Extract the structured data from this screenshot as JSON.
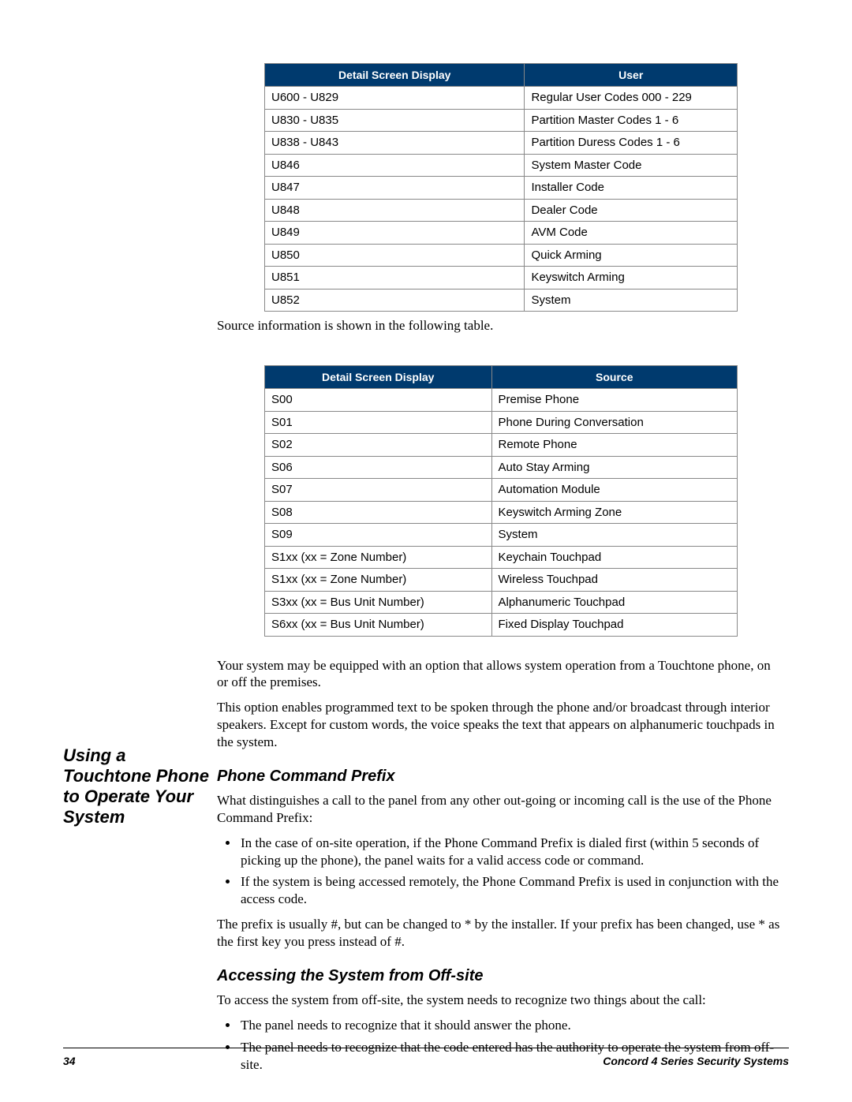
{
  "table1": {
    "headers": [
      "Detail Screen Display",
      "User"
    ],
    "rows": [
      [
        "U600 - U829",
        "Regular User Codes 000 - 229"
      ],
      [
        "U830 - U835",
        "Partition Master Codes 1 - 6"
      ],
      [
        "U838 - U843",
        "Partition Duress Codes 1 - 6"
      ],
      [
        "U846",
        "System Master Code"
      ],
      [
        "U847",
        "Installer Code"
      ],
      [
        "U848",
        "Dealer Code"
      ],
      [
        "U849",
        "AVM Code"
      ],
      [
        "U850",
        "Quick Arming"
      ],
      [
        "U851",
        "Keyswitch Arming"
      ],
      [
        "U852",
        "System"
      ]
    ]
  },
  "caption1": "Source information is shown in the following table.",
  "table2": {
    "headers": [
      "Detail Screen Display",
      "Source"
    ],
    "rows": [
      [
        "S00",
        "Premise Phone"
      ],
      [
        "S01",
        "Phone During Conversation"
      ],
      [
        "S02",
        "Remote Phone"
      ],
      [
        "S06",
        "Auto Stay Arming"
      ],
      [
        "S07",
        "Automation Module"
      ],
      [
        "S08",
        "Keyswitch Arming Zone"
      ],
      [
        "S09",
        "System"
      ],
      [
        "S1xx (xx = Zone Number)",
        "Keychain Touchpad"
      ],
      [
        "S1xx (xx = Zone Number)",
        "Wireless Touchpad"
      ],
      [
        "S3xx (xx = Bus Unit Number)",
        "Alphanumeric Touchpad"
      ],
      [
        "S6xx (xx = Bus Unit Number)",
        "Fixed Display Touchpad"
      ]
    ]
  },
  "side_heading": "Using a Touchtone Phone to Operate Your System",
  "paras": {
    "intro1": "Your system may be equipped with an option that allows system operation from a Touchtone phone, on or off the premises.",
    "intro2": "This option enables programmed text to be spoken through the phone and/or broadcast through interior speakers. Except for custom words, the voice speaks the text that appears on alphanumeric touchpads in the system.",
    "pcp_h": "Phone Command Prefix",
    "pcp1": "What distinguishes a call to the panel from any other out-going or incoming call is the use of the Phone Command Prefix:",
    "pcp_b1": "In the case of on-site operation, if the Phone Command Prefix is dialed first (within 5 seconds of picking up the phone), the panel waits for a valid access code or command.",
    "pcp_b2": "If the system is being accessed remotely, the Phone Command Prefix is used in conjunction with the access code.",
    "pcp2": "The prefix is usually #, but can be changed to * by the installer. If your prefix has been changed, use * as the first key you press instead of #.",
    "acc_h": "Accessing the System from Off-site",
    "acc1": "To access the system from off-site, the system needs to recognize two things about the call:",
    "acc_b1": "The panel needs to recognize that it should answer the phone.",
    "acc_b2": "The panel needs to recognize that the code entered has the authority to operate the system from off-site."
  },
  "page_number": "34",
  "footer": "Concord  4 Series Security Systems"
}
